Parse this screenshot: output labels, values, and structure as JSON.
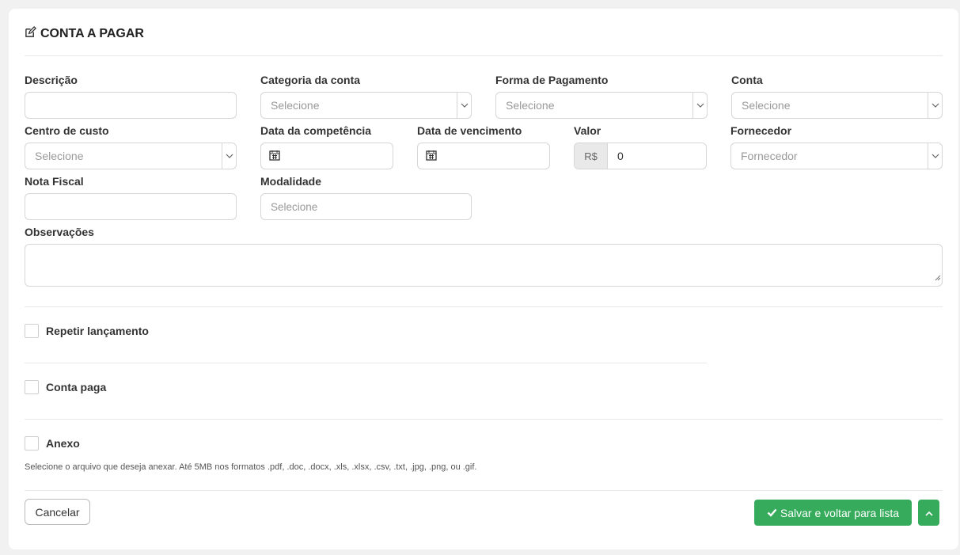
{
  "form": {
    "title": "CONTA A PAGAR",
    "descricao": {
      "label": "Descrição",
      "value": ""
    },
    "categoria": {
      "label": "Categoria da conta",
      "placeholder": "Selecione"
    },
    "forma_pagamento": {
      "label": "Forma de Pagamento",
      "placeholder": "Selecione"
    },
    "conta": {
      "label": "Conta",
      "placeholder": "Selecione"
    },
    "centro_custo": {
      "label": "Centro de custo",
      "placeholder": "Selecione"
    },
    "data_competencia": {
      "label": "Data da competência",
      "value": ""
    },
    "data_vencimento": {
      "label": "Data de vencimento",
      "value": ""
    },
    "valor": {
      "label": "Valor",
      "prefix": "R$",
      "value": "0"
    },
    "fornecedor": {
      "label": "Fornecedor",
      "placeholder": "Fornecedor"
    },
    "nota_fiscal": {
      "label": "Nota Fiscal",
      "value": ""
    },
    "modalidade": {
      "label": "Modalidade",
      "placeholder": "Selecione"
    },
    "observacoes": {
      "label": "Observações",
      "value": ""
    },
    "repetir": {
      "label": "Repetir lançamento",
      "checked": false
    },
    "conta_paga": {
      "label": "Conta paga",
      "checked": false
    },
    "anexo": {
      "label": "Anexo",
      "checked": false,
      "help": "Selecione o arquivo que deseja anexar. Até 5MB nos formatos .pdf, .doc, .docx, .xls, .xlsx, .csv, .txt, .jpg, .png, ou .gif."
    }
  },
  "actions": {
    "cancel": "Cancelar",
    "save": "Salvar e voltar para lista"
  },
  "colors": {
    "primary_button": "#35ab5b",
    "border": "#d6d6d6"
  }
}
